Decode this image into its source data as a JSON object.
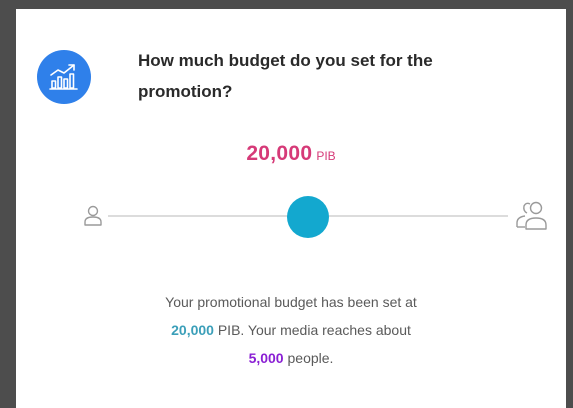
{
  "question": {
    "text": "How much budget do you set for the promotion?"
  },
  "budget": {
    "amount": "20,000",
    "currency": "PIB"
  },
  "slider": {
    "value_fraction": 0.5,
    "min_icon": "single-person-icon",
    "max_icon": "group-of-people-icon"
  },
  "summary": {
    "line1": "Your promotional budget has been set at",
    "budget_amount": "20,000",
    "line2_mid": "PIB. Your media reaches about",
    "reach_amount": "5,000",
    "line3_end": "people."
  },
  "icons": {
    "header": "chart-growth-icon"
  },
  "colors": {
    "header_icon_bg": "#2f80ea",
    "amount_pink": "#d63a78",
    "slider_thumb": "#13a8cf",
    "budget_highlight": "#3b9fb9",
    "reach_highlight": "#8a1fd4"
  }
}
